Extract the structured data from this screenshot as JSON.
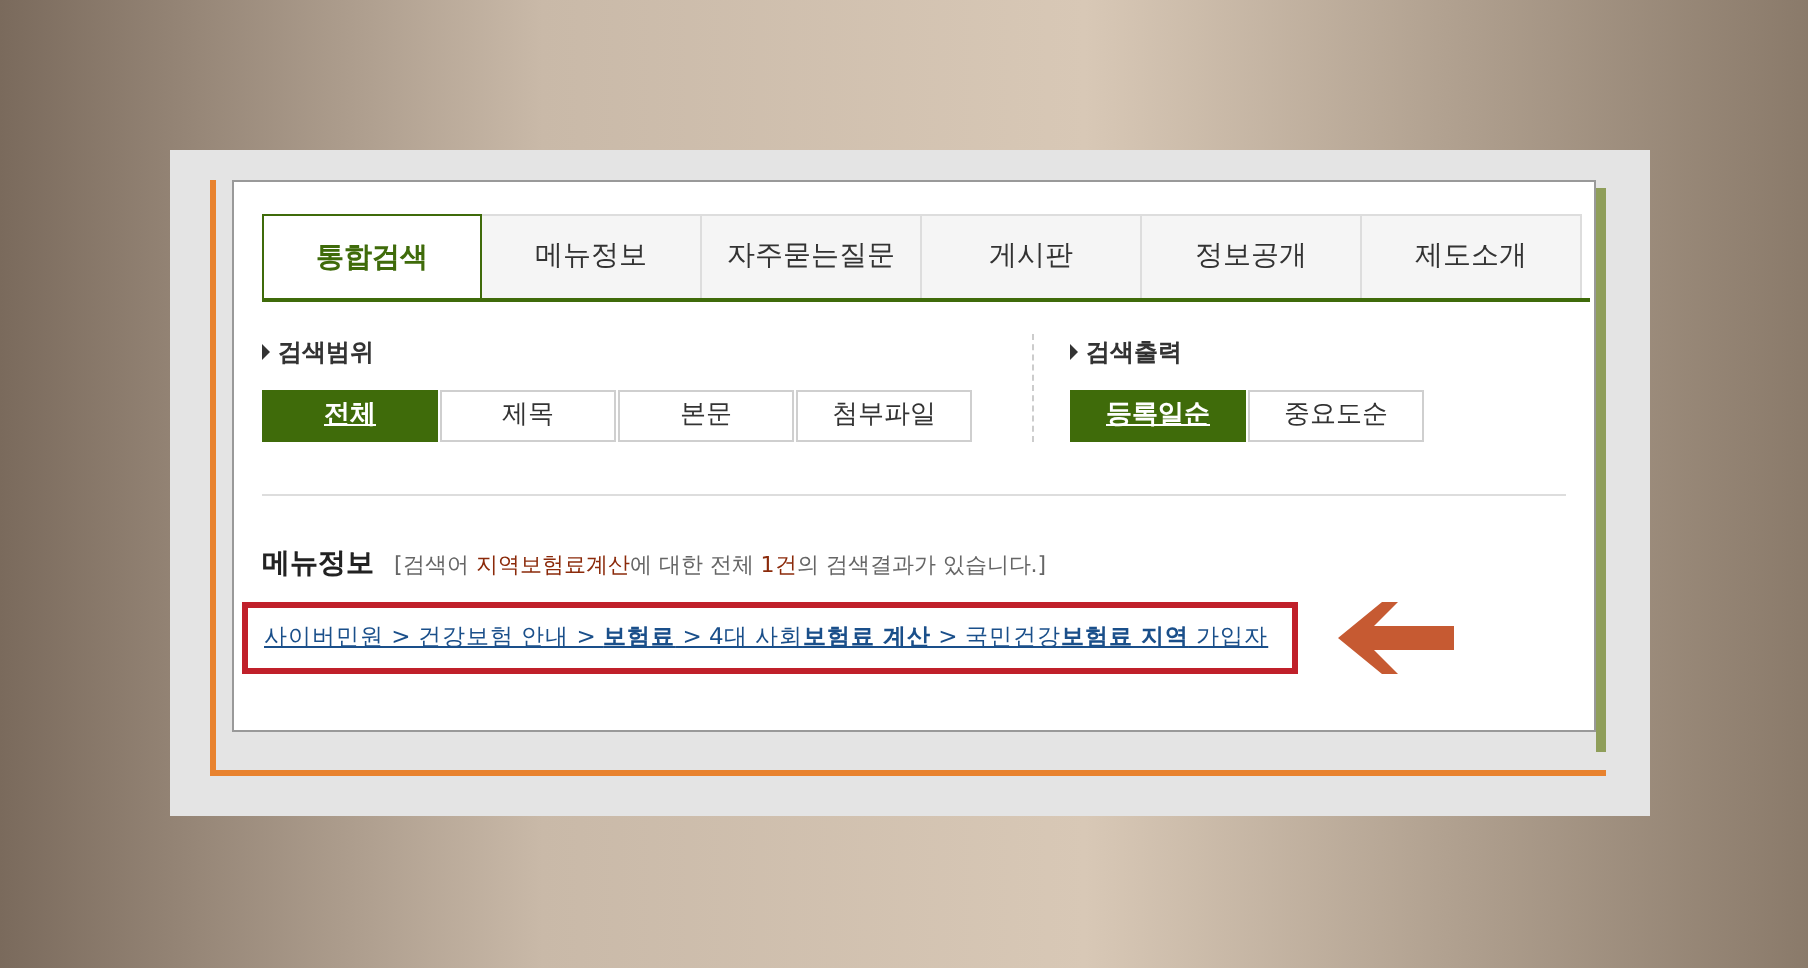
{
  "tabs": [
    {
      "label": "통합검색",
      "selected": true
    },
    {
      "label": "메뉴정보",
      "selected": false
    },
    {
      "label": "자주묻는질문",
      "selected": false
    },
    {
      "label": "게시판",
      "selected": false
    },
    {
      "label": "정보공개",
      "selected": false
    },
    {
      "label": "제도소개",
      "selected": false
    }
  ],
  "search_scope": {
    "title": "검색범위",
    "options": [
      {
        "label": "전체",
        "selected": true
      },
      {
        "label": "제목",
        "selected": false
      },
      {
        "label": "본문",
        "selected": false
      },
      {
        "label": "첨부파일",
        "selected": false
      }
    ]
  },
  "search_output": {
    "title": "검색출력",
    "options": [
      {
        "label": "등록일순",
        "selected": true
      },
      {
        "label": "중요도순",
        "selected": false
      }
    ]
  },
  "result": {
    "heading": "메뉴정보",
    "summary": [
      {
        "kind": "plain",
        "text": "[검색어 "
      },
      {
        "kind": "highlight",
        "text": "지역보험료계산"
      },
      {
        "kind": "plain",
        "text": "에 대한 전체 "
      },
      {
        "kind": "highlight",
        "text": "1건"
      },
      {
        "kind": "plain",
        "text": "의 검색결과가 있습니다.]"
      }
    ],
    "breadcrumb": "사이버민원 > 건강보험 안내 > **보험료** > 4대 사회**보험료 계산** > 국민건강**보험료 지역** 가입자"
  }
}
